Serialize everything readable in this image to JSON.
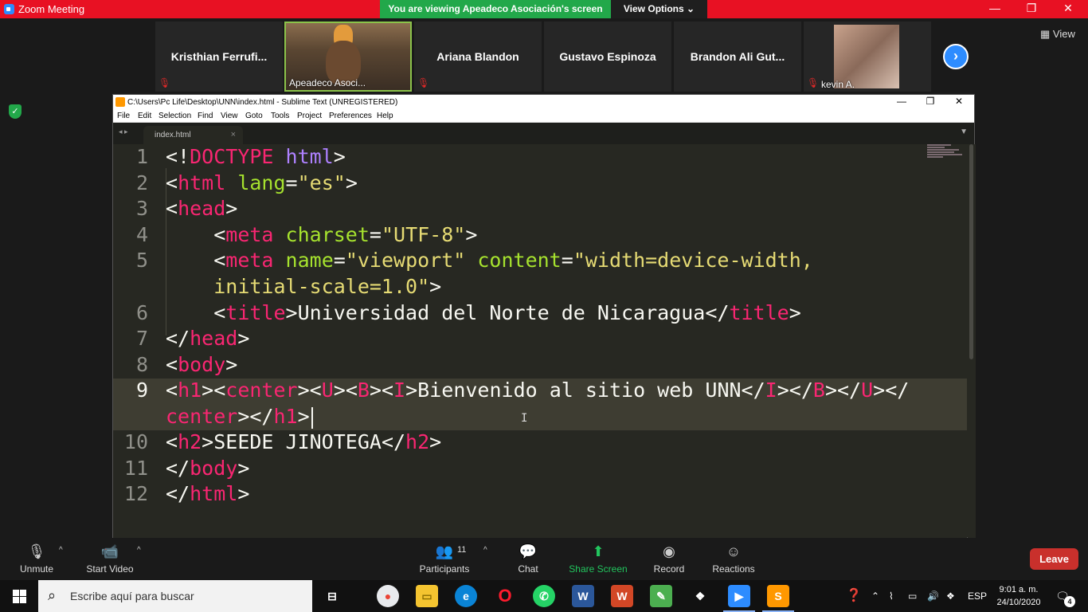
{
  "zoom": {
    "title": "Zoom Meeting",
    "banner": "You are viewing Apeadeco Asociación's screen",
    "view_options": "View Options",
    "view_options_caret": "⌄",
    "view_button": "View",
    "minimize": "—",
    "maximize": "❐",
    "close": "✕",
    "next": "›"
  },
  "participants": [
    {
      "name": "Kristhian  Ferrufi..."
    },
    {
      "name": "Apeadeco Asoci..."
    },
    {
      "name": "Ariana Blandon"
    },
    {
      "name": "Gustavo Espinoza"
    },
    {
      "name": "Brandon Ali Gut..."
    },
    {
      "name": "kevin A."
    }
  ],
  "sublime": {
    "title": "C:\\Users\\Pc Life\\Desktop\\UNN\\index.html - Sublime Text (UNREGISTERED)",
    "menu": [
      "File",
      "Edit",
      "Selection",
      "Find",
      "View",
      "Goto",
      "Tools",
      "Project",
      "Preferences",
      "Help"
    ],
    "tab": "index.html",
    "tab_close": "×",
    "tab_arrows": "◂ ▸",
    "tab_dropdown": "▼",
    "line_numbers": [
      "1",
      "2",
      "3",
      "4",
      "5",
      "6",
      "7",
      "8",
      "9",
      "10",
      "11",
      "12"
    ],
    "code": {
      "l1a": "<!",
      "l1b": "DOCTYPE",
      "l1c": " html",
      "l1d": ">",
      "l2a": "<",
      "l2b": "html",
      "l2c": " lang",
      "l2d": "=",
      "l2e": "\"es\"",
      "l2f": ">",
      "l3a": "<",
      "l3b": "head",
      "l3c": ">",
      "l4a": "    <",
      "l4b": "meta",
      "l4c": " charset",
      "l4d": "=",
      "l4e": "\"UTF-8\"",
      "l4f": ">",
      "l5a": "    <",
      "l5b": "meta",
      "l5c": " name",
      "l5d": "=",
      "l5e": "\"viewport\"",
      "l5f": " content",
      "l5g": "=",
      "l5h": "\"width=device-width,",
      "l5i": "    ",
      "l5j": "initial-scale=1.0\"",
      "l5k": ">",
      "l6a": "    <",
      "l6b": "title",
      "l6c": ">Universidad del Norte de Nicaragua</",
      "l6d": "title",
      "l6e": ">",
      "l7a": "</",
      "l7b": "head",
      "l7c": ">",
      "l8a": "<",
      "l8b": "body",
      "l8c": ">",
      "l9a": "<",
      "l9b": "h1",
      "l9c": "><",
      "l9d": "center",
      "l9e": "><",
      "l9f": "U",
      "l9g": "><",
      "l9h": "B",
      "l9i": "><",
      "l9j": "I",
      "l9k": ">Bienvenido al sitio web UNN</",
      "l9l": "I",
      "l9m": "></",
      "l9n": "B",
      "l9o": "></",
      "l9p": "U",
      "l9q": "></",
      "l9r": "center",
      "l9s": "></",
      "l9t": "h1",
      "l9u": ">",
      "l10a": "<",
      "l10b": "h2",
      "l10c": ">SEEDE JINOTEGA</",
      "l10d": "h2",
      "l10e": ">",
      "l11a": "</",
      "l11b": "body",
      "l11c": ">",
      "l12a": "</",
      "l12b": "html",
      "l12c": ">"
    }
  },
  "controls": {
    "unmute": "Unmute",
    "start_video": "Start Video",
    "participants": "Participants",
    "participants_count": "11",
    "chat": "Chat",
    "share_screen": "Share Screen",
    "record": "Record",
    "reactions": "Reactions",
    "leave": "Leave",
    "caret": "^"
  },
  "taskbar": {
    "search_placeholder": "Escribe aquí para buscar",
    "language": "ESP",
    "time": "9:01 a. m.",
    "date": "24/10/2020",
    "notifications": "4"
  },
  "colors": {
    "zoom_titlebar": "#e81123",
    "banner_green": "#22a84a",
    "sublime_bg": "#272822",
    "tag": "#f92672",
    "attr": "#a6e22e",
    "string": "#e6db74",
    "leave": "#c9302c"
  }
}
